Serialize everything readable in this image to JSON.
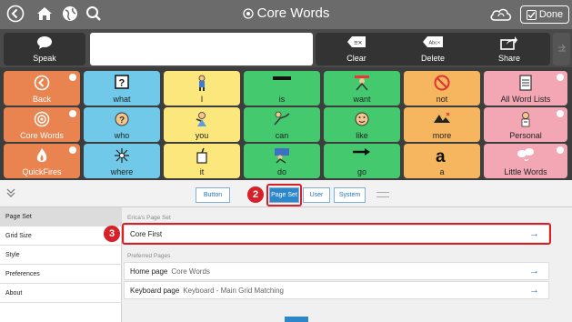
{
  "window": {
    "title": "Core Words",
    "done_label": "Done"
  },
  "toolbar": {
    "speak_label": "Speak",
    "clear_label": "Clear",
    "delete_label": "Delete",
    "share_label": "Share"
  },
  "grid": {
    "cells": [
      {
        "label": "Back"
      },
      {
        "label": "what"
      },
      {
        "label": "I"
      },
      {
        "label": "is"
      },
      {
        "label": "want"
      },
      {
        "label": "not"
      },
      {
        "label": "All Word Lists"
      },
      {
        "label": "Core Words"
      },
      {
        "label": "who"
      },
      {
        "label": "you"
      },
      {
        "label": "can"
      },
      {
        "label": "like"
      },
      {
        "label": "more"
      },
      {
        "label": "Personal"
      },
      {
        "label": "QuickFires"
      },
      {
        "label": "where"
      },
      {
        "label": "it"
      },
      {
        "label": "do"
      },
      {
        "label": "go"
      },
      {
        "label": "a"
      },
      {
        "label": "Little Words"
      }
    ]
  },
  "tabs": [
    {
      "label": "Button"
    },
    {
      "label": "Page Set"
    },
    {
      "label": "User"
    },
    {
      "label": "System"
    }
  ],
  "left_menu": [
    {
      "label": "Page Set"
    },
    {
      "label": "Grid Size"
    },
    {
      "label": "Style"
    },
    {
      "label": "Preferences"
    },
    {
      "label": "About"
    }
  ],
  "panel": {
    "section1_header": "Erica's Page Set",
    "pageset_value": "Core First",
    "section2_header": "Preferred Pages",
    "home_label": "Home page",
    "home_value": "Core Words",
    "keyboard_label": "Keyboard page",
    "keyboard_value": "Keyboard - Main Grid Matching"
  },
  "callouts": {
    "step2": "2",
    "step3": "3"
  },
  "colors": {
    "orange": "#e9834f",
    "yellow": "#fbe77c",
    "green": "#44c96f",
    "light_blue": "#70c9e8",
    "peach": "#f6b65f",
    "pink": "#f3a7b5",
    "accent_blue": "#2d86c9",
    "callout_red": "#d72027"
  },
  "icons": [
    "back-circle-icon",
    "home-icon",
    "globe-icon",
    "search-icon",
    "target-icon",
    "cloud-sync-icon",
    "check-icon",
    "speech-bubble-icon",
    "clear-icon",
    "delete-icon",
    "share-icon",
    "chevron-down-icon",
    "arrow-right-icon"
  ]
}
